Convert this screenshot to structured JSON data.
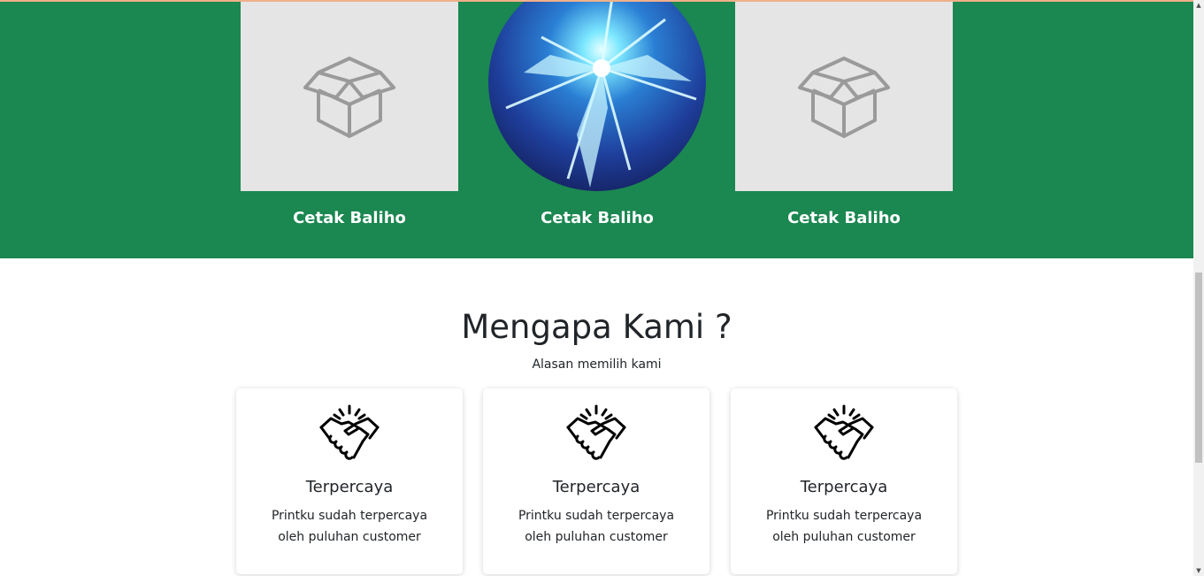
{
  "products": [
    {
      "title": "Cetak Baliho",
      "image": "box-icon"
    },
    {
      "title": "Cetak Baliho",
      "image": "lightning-burst-image"
    },
    {
      "title": "Cetak Baliho",
      "image": "box-icon"
    }
  ],
  "why": {
    "title": "Mengapa Kami ?",
    "subtitle": "Alasan memilih kami"
  },
  "features": [
    {
      "icon": "handshake-icon",
      "title": "Terpercaya",
      "text": "Printku sudah terpercaya oleh puluhan customer"
    },
    {
      "icon": "handshake-icon",
      "title": "Terpercaya",
      "text": "Printku sudah terpercaya oleh puluhan customer"
    },
    {
      "icon": "handshake-icon",
      "title": "Terpercaya",
      "text": "Printku sudah terpercaya oleh puluhan customer"
    }
  ],
  "colors": {
    "green": "#1b8751",
    "placeholder": "#e5e5e5"
  }
}
